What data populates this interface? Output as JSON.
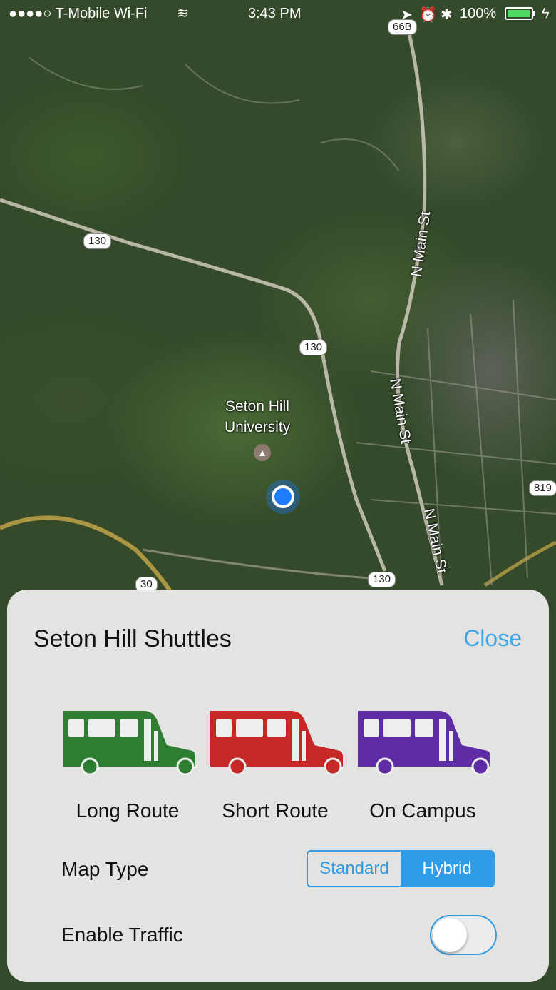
{
  "status_bar": {
    "carrier": "●●●●○ T-Mobile Wi-Fi",
    "time": "3:43 PM",
    "battery": "100%"
  },
  "map": {
    "place_name_line1": "Seton Hill",
    "place_name_line2": "University",
    "road_labels": {
      "n_main_st_1": "N Main St",
      "n_main_st_2": "N Main St",
      "n_main_st_3": "N Main St"
    },
    "shields": {
      "r66b": "66B",
      "r130a": "130",
      "r130b": "130",
      "r130c": "130",
      "r30": "30",
      "r819": "819"
    }
  },
  "panel": {
    "title": "Seton Hill Shuttles",
    "close_label": "Close",
    "routes": [
      {
        "label": "Long Route",
        "color": "#2e7d32"
      },
      {
        "label": "Short Route",
        "color": "#c62828"
      },
      {
        "label": "On Campus",
        "color": "#5e2ca5"
      }
    ],
    "map_type": {
      "label": "Map Type",
      "options": [
        "Standard",
        "Hybrid"
      ],
      "selected": "Hybrid"
    },
    "traffic": {
      "label": "Enable Traffic",
      "enabled": false
    }
  }
}
